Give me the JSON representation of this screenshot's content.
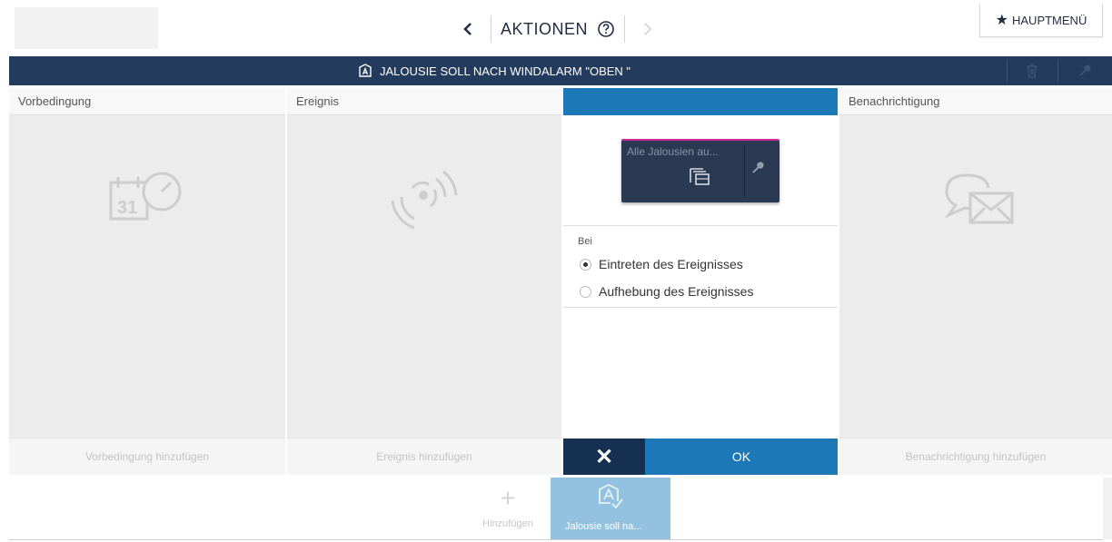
{
  "header": {
    "title": "AKTIONEN",
    "back_icon": "chevron-left-icon",
    "forward_icon": "chevron-right-icon",
    "help_icon": "help-circle-icon",
    "main_menu_label": "HAUPTMENÜ",
    "main_menu_icon": "star-icon"
  },
  "action": {
    "title": "JALOUSIE SOLL NACH WINDALARM \"OBEN \"",
    "title_icon": "automation-a-icon",
    "delete_icon": "trash-icon",
    "settings_icon": "wrench-icon"
  },
  "columns": {
    "precondition": {
      "header": "Vorbedingung",
      "footer": "Vorbedingung hinzufügen",
      "icon": "calendar-clock-icon"
    },
    "event": {
      "header": "Ereignis",
      "footer": "Ereignis hinzufügen",
      "icon": "signal-waves-icon"
    },
    "notification": {
      "header": "Benachrichtigung",
      "footer": "Benachrichtigung hinzufügen",
      "icon": "chat-mail-icon"
    }
  },
  "panel": {
    "tile_label": "Alle Jalousien au...",
    "tile_icon": "blinds-group-icon",
    "tile_settings_icon": "wrench-icon",
    "bei_label": "Bei",
    "options": [
      {
        "label": "Eintreten des Ereignisses",
        "checked": true
      },
      {
        "label": "Aufhebung des Ereignisses",
        "checked": false
      }
    ],
    "cancel_label": "✕",
    "ok_label": "OK"
  },
  "bottom": {
    "add_label": "Hinzufügen",
    "add_icon": "plus-icon",
    "action_tile_label": "Jalousie soll na...",
    "action_tile_icon": "automation-a-icon"
  },
  "colors": {
    "navy": "#233b5c",
    "blue": "#1c78b6",
    "dark_navy": "#153050",
    "tile_bg": "#2a3a52",
    "tile_accent": "#d3269a",
    "light_blue_tile": "#93c2e1"
  }
}
